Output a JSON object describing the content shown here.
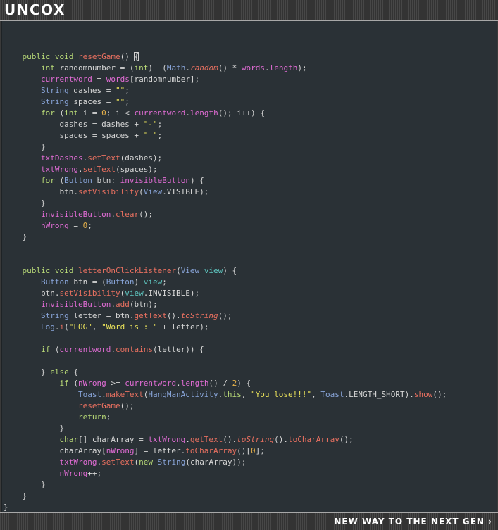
{
  "header": {
    "logo_text": "UNCOX"
  },
  "footer": {
    "tagline": "NEW WAY TO THE NEXT GEN",
    "arrow_icon": "›"
  },
  "colors": {
    "keyword": "#b8d977",
    "field": "#e06cd4",
    "class": "#88a4d8",
    "string": "#e8e05a",
    "number": "#e8b24a",
    "method": "#e87060",
    "parameter": "#5fc7c1",
    "plain": "#d6d6d6",
    "editor_background": "#2a3136"
  },
  "code_lines": [
    [],
    [
      {
        "t": "    "
      },
      {
        "k": "kw",
        "t": "public void "
      },
      {
        "k": "call",
        "t": "resetGame"
      },
      {
        "t": "() "
      },
      {
        "k": "bracket",
        "t": "{"
      }
    ],
    [
      {
        "t": "        "
      },
      {
        "k": "kw",
        "t": "int"
      },
      {
        "t": " randomnumber = ("
      },
      {
        "k": "kw",
        "t": "int"
      },
      {
        "t": ")  ("
      },
      {
        "k": "cls",
        "t": "Math"
      },
      {
        "t": "."
      },
      {
        "k": "it",
        "t": "random"
      },
      {
        "t": "() * "
      },
      {
        "k": "id",
        "t": "words"
      },
      {
        "t": "."
      },
      {
        "k": "prop",
        "t": "length"
      },
      {
        "t": ");"
      }
    ],
    [
      {
        "t": "        "
      },
      {
        "k": "id",
        "t": "currentword"
      },
      {
        "t": " = "
      },
      {
        "k": "id",
        "t": "words"
      },
      {
        "t": "[randomnumber];"
      }
    ],
    [
      {
        "t": "        "
      },
      {
        "k": "cls",
        "t": "String"
      },
      {
        "t": " dashes = "
      },
      {
        "k": "str",
        "t": "\"\""
      },
      {
        "t": ";"
      }
    ],
    [
      {
        "t": "        "
      },
      {
        "k": "cls",
        "t": "String"
      },
      {
        "t": " spaces = "
      },
      {
        "k": "str",
        "t": "\"\""
      },
      {
        "t": ";"
      }
    ],
    [
      {
        "t": "        "
      },
      {
        "k": "kw",
        "t": "for"
      },
      {
        "t": " ("
      },
      {
        "k": "kw",
        "t": "int"
      },
      {
        "t": " i = "
      },
      {
        "k": "num",
        "t": "0"
      },
      {
        "t": "; i < "
      },
      {
        "k": "id",
        "t": "currentword"
      },
      {
        "t": "."
      },
      {
        "k": "prop",
        "t": "length"
      },
      {
        "t": "(); i++) {"
      }
    ],
    [
      {
        "t": "            dashes = dashes + "
      },
      {
        "k": "str",
        "t": "\"-\""
      },
      {
        "t": ";"
      }
    ],
    [
      {
        "t": "            spaces = spaces + "
      },
      {
        "k": "str",
        "t": "\" \""
      },
      {
        "t": ";"
      }
    ],
    [
      {
        "t": "        }"
      }
    ],
    [
      {
        "t": "        "
      },
      {
        "k": "id",
        "t": "txtDashes"
      },
      {
        "t": "."
      },
      {
        "k": "call",
        "t": "setText"
      },
      {
        "t": "(dashes);"
      }
    ],
    [
      {
        "t": "        "
      },
      {
        "k": "id",
        "t": "txtWrong"
      },
      {
        "t": "."
      },
      {
        "k": "call",
        "t": "setText"
      },
      {
        "t": "(spaces);"
      }
    ],
    [
      {
        "t": "        "
      },
      {
        "k": "kw",
        "t": "for"
      },
      {
        "t": " ("
      },
      {
        "k": "cls",
        "t": "Button"
      },
      {
        "t": " btn: "
      },
      {
        "k": "id",
        "t": "invisibleButton"
      },
      {
        "t": ") {"
      }
    ],
    [
      {
        "t": "            btn."
      },
      {
        "k": "call",
        "t": "setVisibility"
      },
      {
        "t": "("
      },
      {
        "k": "cls",
        "t": "View"
      },
      {
        "t": ".VISIBLE);"
      }
    ],
    [
      {
        "t": "        }"
      }
    ],
    [
      {
        "t": "        "
      },
      {
        "k": "id",
        "t": "invisibleButton"
      },
      {
        "t": "."
      },
      {
        "k": "call",
        "t": "clear"
      },
      {
        "t": "();"
      }
    ],
    [
      {
        "t": "        "
      },
      {
        "k": "id",
        "t": "nWrong"
      },
      {
        "t": " = "
      },
      {
        "k": "num",
        "t": "0"
      },
      {
        "t": ";"
      }
    ],
    [
      {
        "t": "    }"
      },
      {
        "k": "cursor",
        "t": ""
      }
    ],
    [],
    [],
    [
      {
        "t": "    "
      },
      {
        "k": "kw",
        "t": "public void "
      },
      {
        "k": "call",
        "t": "letterOnClickListener"
      },
      {
        "t": "("
      },
      {
        "k": "cls",
        "t": "View"
      },
      {
        "t": " "
      },
      {
        "k": "lit",
        "t": "view"
      },
      {
        "t": ") {"
      }
    ],
    [
      {
        "t": "        "
      },
      {
        "k": "cls",
        "t": "Button"
      },
      {
        "t": " btn = ("
      },
      {
        "k": "cls",
        "t": "Button"
      },
      {
        "t": ") "
      },
      {
        "k": "lit",
        "t": "view"
      },
      {
        "t": ";"
      }
    ],
    [
      {
        "t": "        btn."
      },
      {
        "k": "call",
        "t": "setVisibility"
      },
      {
        "t": "("
      },
      {
        "k": "lit",
        "t": "view"
      },
      {
        "t": ".INVISIBLE);"
      }
    ],
    [
      {
        "t": "        "
      },
      {
        "k": "id",
        "t": "invisibleButton"
      },
      {
        "t": "."
      },
      {
        "k": "call",
        "t": "add"
      },
      {
        "t": "(btn);"
      }
    ],
    [
      {
        "t": "        "
      },
      {
        "k": "cls",
        "t": "String"
      },
      {
        "t": " letter = btn."
      },
      {
        "k": "call",
        "t": "getText"
      },
      {
        "t": "()."
      },
      {
        "k": "it",
        "t": "toString"
      },
      {
        "t": "();"
      }
    ],
    [
      {
        "t": "        "
      },
      {
        "k": "cls",
        "t": "Log"
      },
      {
        "t": "."
      },
      {
        "k": "call",
        "t": "i"
      },
      {
        "t": "("
      },
      {
        "k": "str",
        "t": "\"LOG\""
      },
      {
        "t": ", "
      },
      {
        "k": "str",
        "t": "\"Word is : \""
      },
      {
        "t": " + letter);"
      }
    ],
    [],
    [
      {
        "t": "        "
      },
      {
        "k": "kw",
        "t": "if"
      },
      {
        "t": " ("
      },
      {
        "k": "id",
        "t": "currentword"
      },
      {
        "t": "."
      },
      {
        "k": "call",
        "t": "contains"
      },
      {
        "t": "(letter)) {"
      }
    ],
    [],
    [
      {
        "t": "        } "
      },
      {
        "k": "kw",
        "t": "else"
      },
      {
        "t": " {"
      }
    ],
    [
      {
        "t": "            "
      },
      {
        "k": "kw",
        "t": "if"
      },
      {
        "t": " ("
      },
      {
        "k": "id",
        "t": "nWrong"
      },
      {
        "t": " >= "
      },
      {
        "k": "id",
        "t": "currentword"
      },
      {
        "t": "."
      },
      {
        "k": "prop",
        "t": "length"
      },
      {
        "t": "() / "
      },
      {
        "k": "num",
        "t": "2"
      },
      {
        "t": ") {"
      }
    ],
    [
      {
        "t": "                "
      },
      {
        "k": "cls",
        "t": "Toast"
      },
      {
        "t": "."
      },
      {
        "k": "call",
        "t": "makeText"
      },
      {
        "t": "("
      },
      {
        "k": "cls",
        "t": "HangManActivity"
      },
      {
        "t": "."
      },
      {
        "k": "kw",
        "t": "this"
      },
      {
        "t": ", "
      },
      {
        "k": "str",
        "t": "\"You lose!!!\""
      },
      {
        "t": ", "
      },
      {
        "k": "cls",
        "t": "Toast"
      },
      {
        "t": ".LENGTH_SHORT)."
      },
      {
        "k": "call",
        "t": "show"
      },
      {
        "t": "();"
      }
    ],
    [
      {
        "t": "                "
      },
      {
        "k": "call",
        "t": "resetGame"
      },
      {
        "t": "();"
      }
    ],
    [
      {
        "t": "                "
      },
      {
        "k": "kw",
        "t": "return"
      },
      {
        "t": ";"
      }
    ],
    [
      {
        "t": "            }"
      }
    ],
    [
      {
        "t": "            "
      },
      {
        "k": "kw",
        "t": "char"
      },
      {
        "t": "[] charArray = "
      },
      {
        "k": "id",
        "t": "txtWrong"
      },
      {
        "t": "."
      },
      {
        "k": "call",
        "t": "getText"
      },
      {
        "t": "()."
      },
      {
        "k": "it",
        "t": "toString"
      },
      {
        "t": "()."
      },
      {
        "k": "call",
        "t": "toCharArray"
      },
      {
        "t": "();"
      }
    ],
    [
      {
        "t": "            charArray["
      },
      {
        "k": "id",
        "t": "nWrong"
      },
      {
        "t": "] = letter."
      },
      {
        "k": "call",
        "t": "toCharArray"
      },
      {
        "t": "()["
      },
      {
        "k": "num",
        "t": "0"
      },
      {
        "t": "];"
      }
    ],
    [
      {
        "t": "            "
      },
      {
        "k": "id",
        "t": "txtWrong"
      },
      {
        "t": "."
      },
      {
        "k": "call",
        "t": "setText"
      },
      {
        "t": "("
      },
      {
        "k": "kw",
        "t": "new"
      },
      {
        "t": " "
      },
      {
        "k": "cls",
        "t": "String"
      },
      {
        "t": "(charArray));"
      }
    ],
    [
      {
        "t": "            "
      },
      {
        "k": "id",
        "t": "nWrong"
      },
      {
        "t": "++;"
      }
    ],
    [
      {
        "t": "        }"
      }
    ],
    [
      {
        "t": "    }"
      }
    ],
    [
      {
        "t": "}"
      }
    ]
  ]
}
